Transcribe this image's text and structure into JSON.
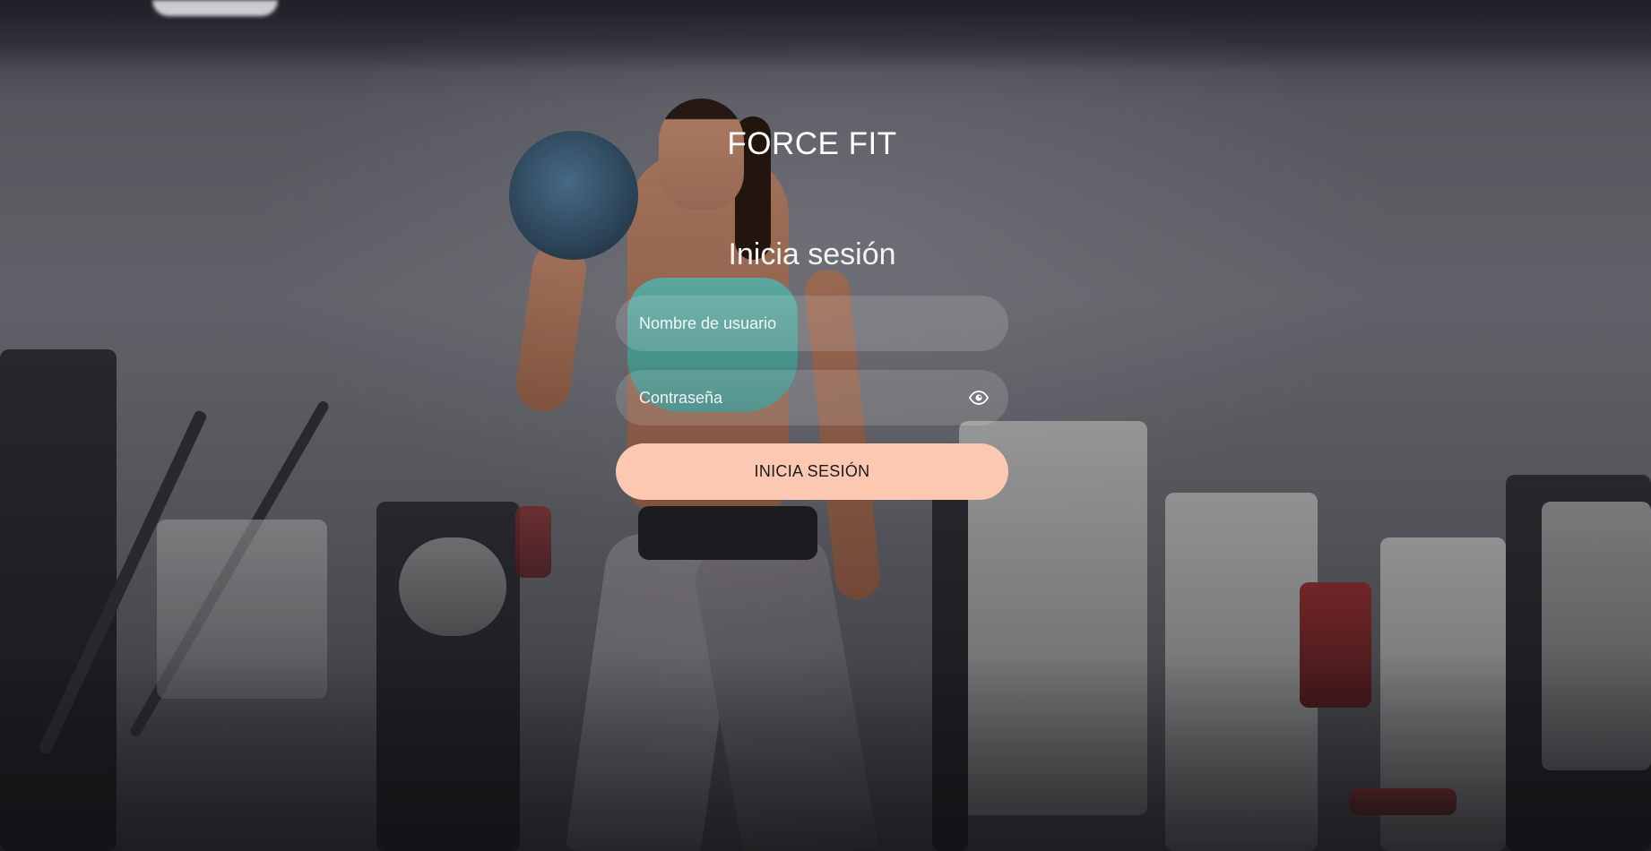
{
  "brand": {
    "name": "FORCE FIT"
  },
  "login": {
    "title": "Inicia sesión",
    "username": {
      "placeholder": "Nombre de usuario",
      "value": ""
    },
    "password": {
      "placeholder": "Contraseña",
      "value": "",
      "toggle_icon": "eye-icon"
    },
    "submit_label": "INICIA SESIÓN"
  },
  "colors": {
    "submit_button": "#fdc8b1",
    "field_background": "rgba(255,255,255,0.14)",
    "text": "#ffffff"
  },
  "background": {
    "icon": "gym-photo-background"
  }
}
